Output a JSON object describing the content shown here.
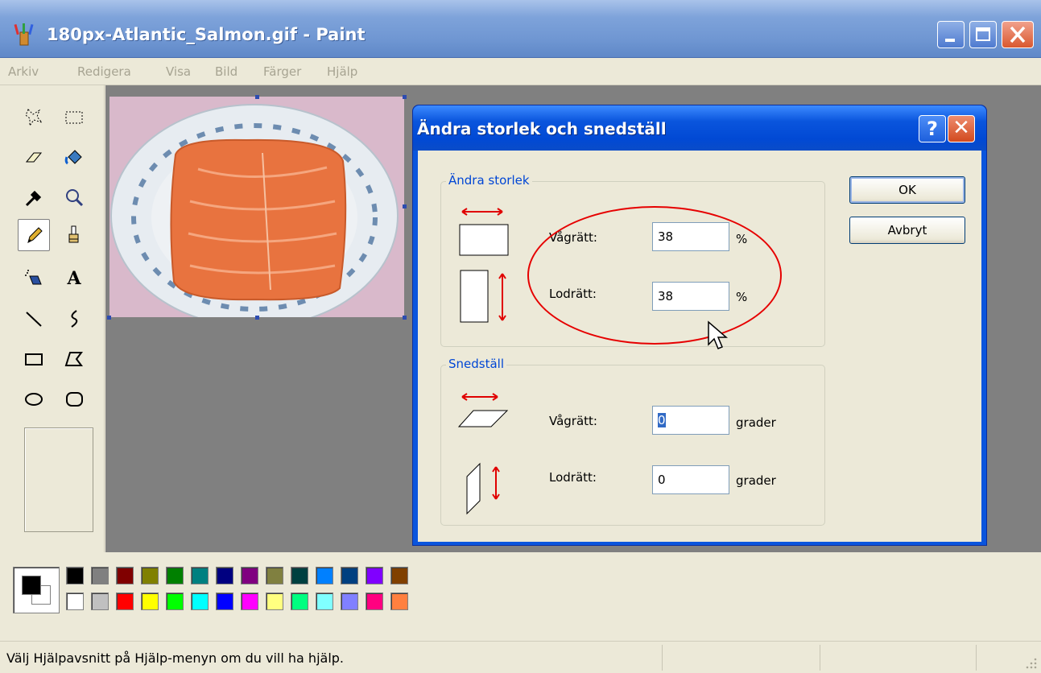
{
  "window": {
    "title": "180px-Atlantic_Salmon.gif - Paint"
  },
  "menu": [
    "Arkiv",
    "Redigera",
    "Visa",
    "Bild",
    "Färger",
    "Hjälp"
  ],
  "tools": [
    "free-form-select",
    "rectangle-select",
    "eraser",
    "fill",
    "color-picker",
    "magnifier",
    "pencil",
    "brush",
    "airbrush",
    "text",
    "line",
    "curve",
    "rectangle",
    "polygon",
    "ellipse",
    "rounded-rectangle"
  ],
  "active_tool": "pencil",
  "palette": {
    "foreground": "#000000",
    "background": "#ffffff",
    "top_row": [
      "#000000",
      "#808080",
      "#800000",
      "#808000",
      "#008000",
      "#008080",
      "#000080",
      "#800080",
      "#808040",
      "#004040",
      "#0080ff",
      "#004080",
      "#8000ff",
      "#804000"
    ],
    "bottom_row": [
      "#ffffff",
      "#c0c0c0",
      "#ff0000",
      "#ffff00",
      "#00ff00",
      "#00ffff",
      "#0000ff",
      "#ff00ff",
      "#ffff80",
      "#00ff80",
      "#80ffff",
      "#8080ff",
      "#ff0080",
      "#ff8040"
    ]
  },
  "status": {
    "text": "Välj Hjälpavsnitt på Hjälp-menyn om du vill ha hjälp."
  },
  "dialog": {
    "title": "Ändra storlek och snedställ",
    "help_glyph": "?",
    "close_glyph": "✕",
    "ok_label": "OK",
    "cancel_label": "Avbryt",
    "resize": {
      "legend": "Ändra storlek",
      "horizontal_label": "Vågrätt:",
      "horizontal_value": "38",
      "horizontal_unit": "%",
      "vertical_label": "Lodrätt:",
      "vertical_value": "38",
      "vertical_unit": "%"
    },
    "skew": {
      "legend": "Snedställ",
      "horizontal_label": "Vågrätt:",
      "horizontal_value": "0",
      "horizontal_unit": "grader",
      "vertical_label": "Lodrätt:",
      "vertical_value": "0",
      "vertical_unit": "grader"
    }
  },
  "colors": {
    "annotation_ellipse": "#e60000",
    "dialog_frame": "#0a55dd",
    "group_label": "#0046d5",
    "workspace": "#808080"
  }
}
